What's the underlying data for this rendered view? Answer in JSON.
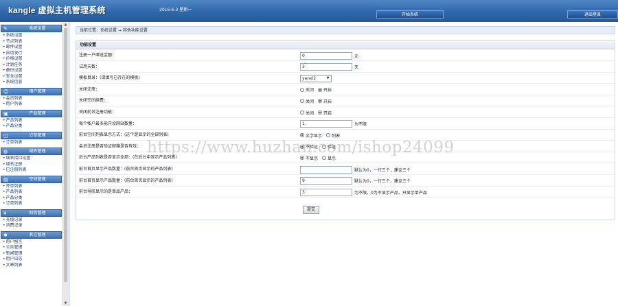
{
  "header": {
    "title": "kangle 虚拟主机管理系统",
    "date": "2016-6-3 星期一",
    "buttons": [
      "开始系统",
      "退出登录"
    ]
  },
  "colors": {
    "header": "#2f68aa",
    "group_head": "#4f82c0",
    "link": "#1a3b8a"
  },
  "sidebar": {
    "groups": [
      {
        "icon": "wrench-icon",
        "label": "系统设置",
        "items": [
          "系统设置",
          "节点列表",
          "邮件设置",
          "自动发行",
          "价格设置",
          "计划任务",
          "备份设置",
          "安全设置",
          "系统信息"
        ]
      },
      {
        "icon": "user-icon",
        "label": "用户管理",
        "items": [
          "会员列表",
          "用户列表"
        ]
      },
      {
        "icon": "box-icon",
        "label": "产品管理",
        "items": [
          "产品列表",
          "产品分类"
        ]
      },
      {
        "icon": "cart-icon",
        "label": "订单管理",
        "items": [
          "订单列表"
        ]
      },
      {
        "icon": "globe-icon",
        "label": "域名管理",
        "items": [
          "域名接口设置",
          "域名注册",
          "已注册列表"
        ]
      },
      {
        "icon": "server-icon",
        "label": "空间管理",
        "items": [
          "开单列表",
          "产品列表",
          "产品分类",
          "订单列表"
        ]
      },
      {
        "icon": "money-icon",
        "label": "财务管理",
        "items": [
          "充值记录",
          "消费记录"
        ]
      },
      {
        "icon": "gear-icon",
        "label": "其它管理",
        "items": [
          "用户留言",
          "公告管理",
          "新闻管理",
          "用户日志",
          "文章列表"
        ]
      }
    ]
  },
  "main": {
    "breadcrumb": "当前位置：系统设置 → 其他功能设置",
    "panel_title": "功能设置",
    "rows": [
      {
        "label": "注册一户赠送金额：",
        "type": "text",
        "value": "0",
        "suffix": "元"
      },
      {
        "label": "试用天数：",
        "type": "text",
        "value": "3",
        "suffix": "天"
      },
      {
        "label": "模板目录：(请填写已存在的模板)",
        "type": "select",
        "value": "yanxi2"
      },
      {
        "label": "关闭注册：",
        "type": "radio",
        "options": [
          "关闭",
          "开启"
        ],
        "selected": 1
      },
      {
        "label": "关闭空间续费：",
        "type": "radio",
        "options": [
          "关闭",
          "开启"
        ],
        "selected": 1
      },
      {
        "label": "关闭前台注册功能：",
        "type": "radio",
        "options": [
          "关闭",
          "开启"
        ],
        "selected": 1
      },
      {
        "label": "每个帐户最多能开设网站数量：",
        "type": "text",
        "value": "1",
        "suffix": "为不限"
      },
      {
        "label": "前台空间列表显示方式：(这个是显示的全部列表)",
        "type": "radio",
        "options": [
          "文字显示",
          "列表"
        ],
        "selected": 0
      },
      {
        "label": "会员注册是否验证邮箱是否有效：",
        "type": "radio",
        "options": [
          "不验证",
          "验证"
        ],
        "selected": 0
      },
      {
        "label": "后台产品列表是否显示全部：(在后台中显示产品列表)",
        "type": "radio",
        "options": [
          "不显示",
          "显示"
        ],
        "selected": 0
      },
      {
        "label": "前台首页显示产品数量：(前台首页显示的产品列表)",
        "type": "text",
        "value": "",
        "suffix": "默认为0，一行三个，建议三个"
      },
      {
        "label": "前台首页显示产品数量：(前台首页显示的产品列表)",
        "type": "text",
        "value": "9",
        "suffix": "默认为0，一行三个，建议三个"
      },
      {
        "label": "前台导航显示的是单品产品：",
        "type": "text",
        "value": "3",
        "suffix": "为不限，0为不显示产品，只显示单产品"
      }
    ],
    "submit_label": "提交"
  },
  "watermark": "https://www.huzhan.com/ishop24099"
}
